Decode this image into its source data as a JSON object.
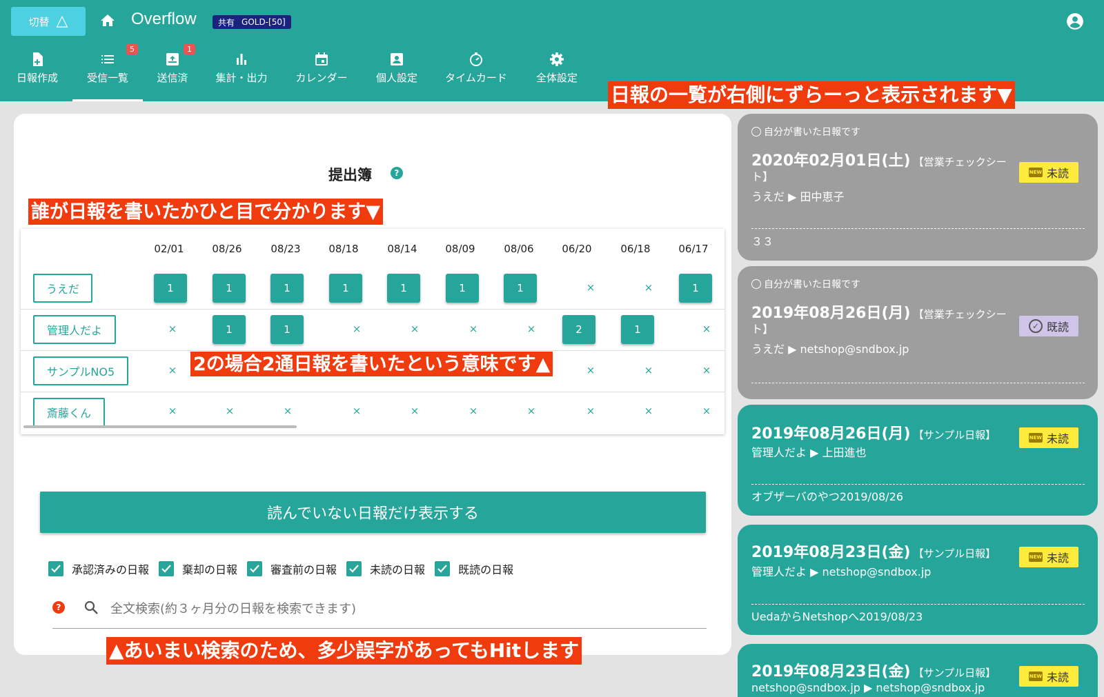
{
  "header": {
    "switch_label": "切替",
    "app_title": "Overflow",
    "plan_shared": "共有",
    "plan_name": "GOLD-[50]"
  },
  "nav": [
    {
      "label": "日報作成",
      "icon": "new-report-icon"
    },
    {
      "label": "受信一覧",
      "icon": "list-icon",
      "badge": "5"
    },
    {
      "label": "送信済",
      "icon": "outbox-icon",
      "badge": "1"
    },
    {
      "label": "集計・出力",
      "icon": "bar-chart-icon"
    },
    {
      "label": "カレンダー",
      "icon": "calendar-icon"
    },
    {
      "label": "個人設定",
      "icon": "person-icon"
    },
    {
      "label": "タイムカード",
      "icon": "timer-icon"
    },
    {
      "label": "全体設定",
      "icon": "gear-icon"
    }
  ],
  "annotations": {
    "right_list": "日報の一覧が右側にずらーっと表示されます▼",
    "who_wrote": "誰が日報を書いたかひと目で分かります▼",
    "meaning_two": "2の場合2通日報を書いたという意味です▲",
    "fuzzy_search": "▲あいまい検索のため、多少誤字があってもHitします"
  },
  "submission": {
    "title": "提出簿",
    "help": "?",
    "dates": [
      "02/01",
      "08/26",
      "08/23",
      "08/18",
      "08/14",
      "08/09",
      "08/06",
      "06/20",
      "06/18",
      "06/17"
    ],
    "rows": [
      {
        "name": "うえだ",
        "cells": [
          "1",
          "1",
          "1",
          "1",
          "1",
          "1",
          "1",
          "×",
          "×",
          "1"
        ]
      },
      {
        "name": "管理人だよ",
        "cells": [
          "×",
          "1",
          "1",
          "×",
          "×",
          "×",
          "×",
          "2",
          "1",
          "×"
        ]
      },
      {
        "name": "サンプルNO5",
        "cells": [
          "×",
          "×",
          "×",
          "×",
          "×",
          "×",
          "×",
          "×",
          "×",
          "×"
        ]
      },
      {
        "name": "斎藤くん",
        "cells": [
          "×",
          "×",
          "×",
          "×",
          "×",
          "×",
          "×",
          "×",
          "×",
          "×"
        ]
      }
    ]
  },
  "unread_button": "読んでいない日報だけ表示する",
  "filters": [
    "承認済みの日報",
    "棄却の日報",
    "審査前の日報",
    "未読の日報",
    "既読の日報"
  ],
  "search": {
    "help": "?",
    "placeholder": "全文検索(約３ヶ月分の日報を検索できます)"
  },
  "reports": [
    {
      "mine": "自分が書いた日報です",
      "date": "2020年02月01日(土)",
      "form_line1": "【営業チェックシー",
      "form_line2": "ト】",
      "from": "うえだ",
      "to": "田中恵子",
      "status": "未読",
      "comment": "３３",
      "style": "gray"
    },
    {
      "mine": "自分が書いた日報です",
      "date": "2019年08月26日(月)",
      "form_line1": "【営業チェックシー",
      "form_line2": "ト】",
      "from": "うえだ",
      "to": "netshop@sndbox.jp",
      "status": "既読",
      "comment": "",
      "style": "gray"
    },
    {
      "mine": "",
      "date": "2019年08月26日(月)",
      "form_line1": "【サンプル日報】",
      "form_line2": "",
      "from": "管理人だよ",
      "to": "上田進也",
      "status": "未読",
      "comment": "オブザーバのやつ2019/08/26",
      "style": "teal"
    },
    {
      "mine": "",
      "date": "2019年08月23日(金)",
      "form_line1": "【サンプル日報】",
      "form_line2": "",
      "from": "管理人だよ",
      "to": "netshop@sndbox.jp",
      "status": "未読",
      "comment": "UedaからNetshopへ2019/08/23",
      "style": "teal"
    },
    {
      "mine": "",
      "date": "2019年08月23日(金)",
      "form_line1": "【サンプル日報】",
      "form_line2": "",
      "from": "netshop@sndbox.jp",
      "to": "netshop@sndbox.jp",
      "status": "未読",
      "comment": "",
      "style": "teal"
    }
  ],
  "new_chip_text": "NEW",
  "colors": {
    "primary": "#26a69a",
    "annotation": "#ef3b0e",
    "unread": "#ffeb3b",
    "read": "#d1c4e9",
    "mine_card": "#9e9e9e"
  }
}
